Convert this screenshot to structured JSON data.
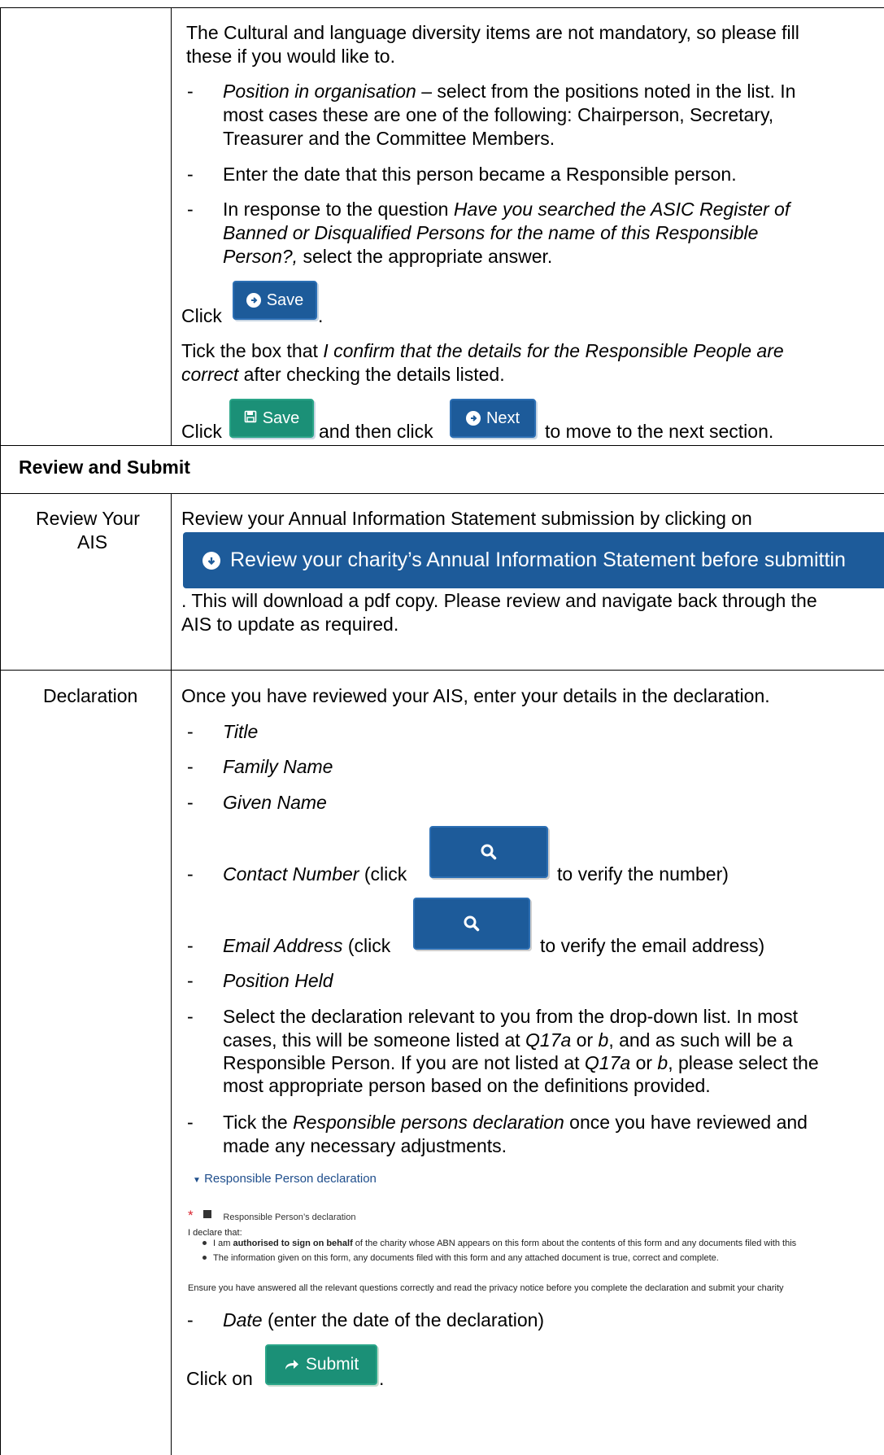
{
  "section1": {
    "intro_line1": "The Cultural and language diversity items are not mandatory, so please fill",
    "intro_line2": "these if you would like to.",
    "pos_italic": "Position in organisation",
    "pos_rest1": " – select from the positions noted in the list. In",
    "pos_line2": "most cases these are one of the following: Chairperson, Secretary,",
    "pos_line3": "Treasurer and the Committee Members.",
    "date_line": "Enter the date that this person became a Responsible person.",
    "asic_start": "In response to the question ",
    "asic_italic1": "Have you searched the ASIC Register of",
    "asic_italic2": "Banned or Disqualified Persons for the name of this Responsible",
    "asic_italic3": "Person?,",
    "asic_end": " select the appropriate answer.",
    "click1": "Click",
    "save_btn": "Save",
    "dot1": ".",
    "tick_start": "Tick the box that ",
    "tick_italic1": "I confirm that the details for the Responsible People are",
    "tick_italic2": "correct",
    "tick_end": " after checking the details listed.",
    "click2": "Click",
    "save_btn2": "Save",
    "and_then": "and then click",
    "next_btn": "Next",
    "to_move": "to move to the next section."
  },
  "section_header": "Review and Submit",
  "review": {
    "label_line1": "Review Your",
    "label_line2": "AIS",
    "line1": "Review your Annual Information Statement submission by clicking on",
    "banner": "Review your charity’s Annual Information Statement before submittin",
    "line2": ". This will download a pdf copy. Please review and navigate back through the",
    "line3": "AIS to update as required."
  },
  "declaration": {
    "label": "Declaration",
    "intro": "Once you have reviewed your AIS, enter your details in the declaration.",
    "title": "Title",
    "family": "Family Name",
    "given": "Given Name",
    "contact_italic": "Contact Number",
    "contact_mid": " (click",
    "contact_end": "to verify the number)",
    "email_italic": "Email Address",
    "email_mid": " (click",
    "email_end": "to verify the email address)",
    "position": "Position Held",
    "select1": "Select the declaration relevant to you from the drop-down list. In most",
    "select2a": "cases, this will be someone listed at ",
    "select2b": "Q17a",
    "select2c": " or ",
    "select2d": "b",
    "select2e": ", and as such will be a",
    "select3a": "Responsible Person. If you are not listed at ",
    "select3b": "Q17a",
    "select3c": " or ",
    "select3d": "b",
    "select3e": ", please select the",
    "select4": "most appropriate person based on the definitions provided.",
    "tickrp_a": "Tick the ",
    "tickrp_b": "Responsible persons declaration",
    "tickrp_c": " once you have reviewed and",
    "tickrp2": "made any necessary adjustments.",
    "rp_header": "Responsible Person declaration",
    "rp_checkbox": "Responsible Person’s declaration",
    "rp_declare": "I declare that:",
    "rp_b1a": "I am ",
    "rp_b1b": "authorised to sign on behalf",
    "rp_b1c": " of the charity whose ABN appears on this form about the contents of this form and any documents filed with this",
    "rp_b2": "The information given on this form, any documents filed with this form and any attached document is true, correct and complete.",
    "rp_ensure": "Ensure you have answered all the relevant questions correctly and read the privacy notice before you complete the declaration and submit your charity",
    "date_italic": "Date",
    "date_rest": " (enter the date of the declaration)",
    "click_on": "Click on",
    "submit_btn": "Submit",
    "dot": "."
  },
  "dash": "-",
  "colors": {
    "blue_button": "#1d5b9a",
    "green_button": "#1b9077",
    "link_blue": "#1f4e8c",
    "required_red": "#d9232e"
  },
  "icons": [
    "arrow-circle-right-icon",
    "floppy-disk-icon",
    "arrow-circle-down-icon",
    "search-icon",
    "share-arrow-icon",
    "caret-down-icon"
  ]
}
